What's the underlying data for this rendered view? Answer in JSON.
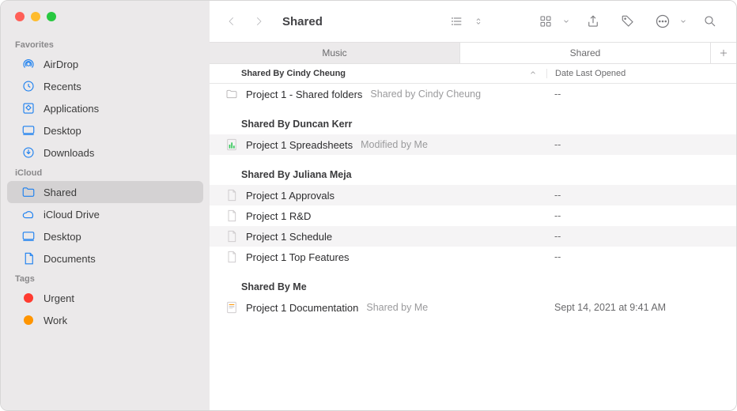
{
  "window": {
    "title": "Shared"
  },
  "sidebar": {
    "sections": [
      {
        "label": "Favorites",
        "items": [
          {
            "name": "AirDrop",
            "icon": "airdrop-icon"
          },
          {
            "name": "Recents",
            "icon": "clock-icon"
          },
          {
            "name": "Applications",
            "icon": "apps-icon"
          },
          {
            "name": "Desktop",
            "icon": "desktop-icon"
          },
          {
            "name": "Downloads",
            "icon": "download-icon"
          }
        ]
      },
      {
        "label": "iCloud",
        "items": [
          {
            "name": "Shared",
            "icon": "shared-folder-icon",
            "selected": true
          },
          {
            "name": "iCloud Drive",
            "icon": "cloud-icon"
          },
          {
            "name": "Desktop",
            "icon": "desktop-icon"
          },
          {
            "name": "Documents",
            "icon": "doc-icon"
          }
        ]
      },
      {
        "label": "Tags",
        "items": [
          {
            "name": "Urgent",
            "tagColor": "#ff3b30"
          },
          {
            "name": "Work",
            "tagColor": "#ff9500"
          }
        ]
      }
    ]
  },
  "tabs": [
    {
      "label": "Music",
      "active": true
    },
    {
      "label": "Shared",
      "active": false
    }
  ],
  "columns": {
    "name": "Shared By Cindy Cheung",
    "date": "Date Last Opened"
  },
  "groups": [
    {
      "title": "Shared By Cindy Cheung",
      "rows": [
        {
          "icon": "folder",
          "name": "Project 1 - Shared folders",
          "subtitle": "Shared by Cindy Cheung",
          "date": "--"
        }
      ]
    },
    {
      "title": "Shared By Duncan Kerr",
      "rows": [
        {
          "icon": "numbers",
          "name": "Project 1 Spreadsheets",
          "subtitle": "Modified by Me",
          "date": "--"
        }
      ]
    },
    {
      "title": "Shared By Juliana Meja",
      "rows": [
        {
          "icon": "page",
          "name": "Project 1 Approvals",
          "subtitle": "",
          "date": "--"
        },
        {
          "icon": "page",
          "name": "Project 1 R&D",
          "subtitle": "",
          "date": "--"
        },
        {
          "icon": "page",
          "name": "Project 1 Schedule",
          "subtitle": "",
          "date": "--"
        },
        {
          "icon": "page",
          "name": "Project 1 Top Features",
          "subtitle": "",
          "date": "--"
        }
      ]
    },
    {
      "title": "Shared By Me",
      "rows": [
        {
          "icon": "pages",
          "name": "Project 1 Documentation",
          "subtitle": "Shared by Me",
          "date": "Sept 14, 2021 at 9:41 AM"
        }
      ]
    }
  ]
}
